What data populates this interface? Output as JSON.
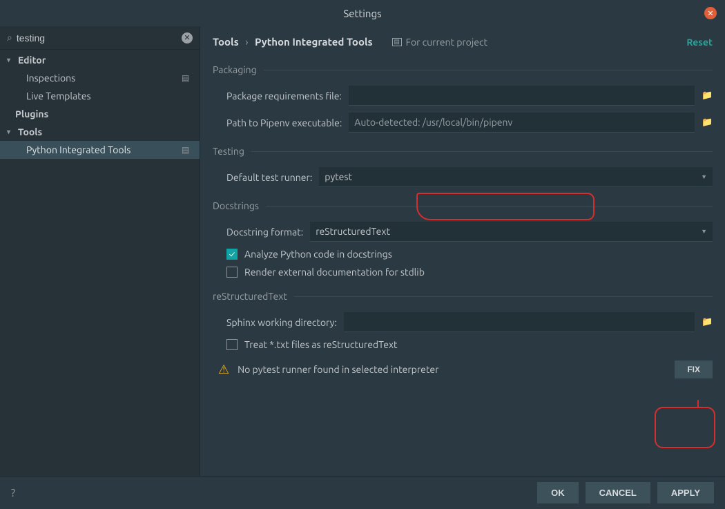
{
  "title": "Settings",
  "search_value": "testing",
  "sidebar": {
    "editor": "Editor",
    "inspections": "Inspections",
    "live_templates": "Live Templates",
    "plugins": "Plugins",
    "tools": "Tools",
    "pit": "Python Integrated Tools"
  },
  "breadcrumb": {
    "root": "Tools",
    "leaf": "Python Integrated Tools"
  },
  "for_current_project": "For current project",
  "reset": "Reset",
  "packaging": {
    "title": "Packaging",
    "req_label": "Package requirements file:",
    "pipenv_label": "Path to Pipenv executable:",
    "pipenv_value": "Auto-detected: /usr/local/bin/pipenv"
  },
  "testing": {
    "title": "Testing",
    "runner_label": "Default test runner:",
    "runner_value": "pytest"
  },
  "docstrings": {
    "title": "Docstrings",
    "format_label": "Docstring format:",
    "format_value": "reStructuredText",
    "analyze": "Analyze Python code in docstrings",
    "render": "Render external documentation for stdlib"
  },
  "rst": {
    "title": "reStructuredText",
    "sphinx_label": "Sphinx working directory:",
    "treat_txt": "Treat *.txt files as reStructuredText"
  },
  "warning": "No pytest runner found in selected interpreter",
  "fix": "FIX",
  "buttons": {
    "ok": "OK",
    "cancel": "CANCEL",
    "apply": "APPLY"
  }
}
